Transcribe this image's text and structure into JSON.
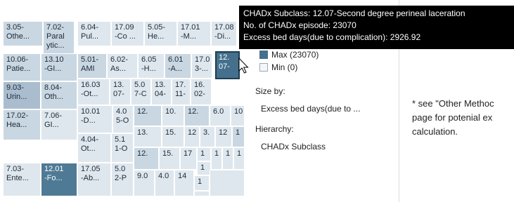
{
  "treemap": {
    "cells": [
      {
        "label": "3.05-\nOthe...",
        "color": "#c9d7e2"
      },
      {
        "label": "7.02-\nParal\nytic...",
        "color": "#c9d7e2"
      },
      {
        "label": "6.04-\nPul...",
        "color": "#dfe7ee"
      },
      {
        "label": "17.09\n-Co ...",
        "color": "#dfe7ee"
      },
      {
        "label": "5.05-\nHe...",
        "color": "#dfe7ee"
      },
      {
        "label": "17.01\n-M...",
        "color": "#dfe7ee"
      },
      {
        "label": "17.08\n-Di...",
        "color": "#dfe7ee"
      },
      {
        "label": "12.\n07-",
        "color": "#44708d"
      },
      {
        "label": "10.06-\nPatie...",
        "color": "#c9d7e2"
      },
      {
        "label": "13.10\n-GI...",
        "color": "#c9d7e2"
      },
      {
        "label": "5.01-\nAMI",
        "color": "#c9d7e2"
      },
      {
        "label": "6.02-\nAs...",
        "color": "#dfe7ee"
      },
      {
        "label": "6.05\n-H...",
        "color": "#dfe7ee"
      },
      {
        "label": "6.01\n-A...",
        "color": "#c9d7e2"
      },
      {
        "label": "17.0\n3-...",
        "color": "#dfe7ee"
      },
      {
        "label": "16.03\n-Ot...",
        "color": "#dfe7ee"
      },
      {
        "label": "13.\n07-",
        "color": "#dfe7ee"
      },
      {
        "label": "5.0\n7-C",
        "color": "#dfe7ee"
      },
      {
        "label": "13.\n04-",
        "color": "#dfe7ee"
      },
      {
        "label": "17.\n11-",
        "color": "#dfe7ee"
      },
      {
        "label": "16.\n02-",
        "color": "#dfe7ee"
      },
      {
        "label": "9.03-\nUrin...",
        "color": "#aabdce"
      },
      {
        "label": "8.04-\nOth...",
        "color": "#c9d7e2"
      },
      {
        "label": "10.01\n-D...",
        "color": "#dfe7ee"
      },
      {
        "label": "4.0\n5-O",
        "color": "#dfe7ee"
      },
      {
        "label": "12.",
        "color": "#c9d7e2"
      },
      {
        "label": "10.",
        "color": "#dfe7ee"
      },
      {
        "label": "12.",
        "color": "#c9d7e2"
      },
      {
        "label": "6.0",
        "color": "#dfe7ee"
      },
      {
        "label": "10",
        "color": "#dfe7ee"
      },
      {
        "label": "17.02-\nHea...",
        "color": "#c9d7e2"
      },
      {
        "label": "7.06-\nGI...",
        "color": "#dfe7ee"
      },
      {
        "label": "4.04-\nOt...",
        "color": "#dfe7ee"
      },
      {
        "label": "5.1\n1-O",
        "color": "#dfe7ee"
      },
      {
        "label": "13.",
        "color": "#dfe7ee"
      },
      {
        "label": "15.",
        "color": "#dfe7ee"
      },
      {
        "label": "12",
        "color": "#dfe7ee"
      },
      {
        "label": "3.",
        "color": "#dfe7ee"
      },
      {
        "label": "12",
        "color": "#dfe7ee"
      },
      {
        "label": "1",
        "color": "#c9d7e2"
      },
      {
        "label": "12.",
        "color": "#c9d7e2"
      },
      {
        "label": "15.",
        "color": "#dfe7ee"
      },
      {
        "label": "17",
        "color": "#dfe7ee"
      },
      {
        "label": "1",
        "color": "#dfe7ee"
      },
      {
        "label": "1",
        "color": "#dfe7ee"
      },
      {
        "label": "1",
        "color": "#dfe7ee"
      },
      {
        "label": "1",
        "color": "#dfe7ee"
      },
      {
        "label": "1",
        "color": "#dfe7ee"
      },
      {
        "label": "7.03-\nEnte...",
        "color": "#dfe7ee"
      },
      {
        "label": "12.01\n-Fo...",
        "color": "#4f7a96"
      },
      {
        "label": "17.05\n-Ab...",
        "color": "#dfe7ee"
      },
      {
        "label": "5.0\n2-P",
        "color": "#dfe7ee"
      },
      {
        "label": "9.0",
        "color": "#dfe7ee"
      },
      {
        "label": "4.0",
        "color": "#dfe7ee"
      },
      {
        "label": "14",
        "color": "#dfe7ee"
      },
      {
        "label": "1",
        "color": "#dfe7ee"
      },
      {
        "label": "",
        "color": "#dfe7ee"
      },
      {
        "label": "",
        "color": "#dfe7ee"
      },
      {
        "label": "",
        "color": "#dfe7ee"
      }
    ]
  },
  "legend": {
    "max_label": "Max (23070)",
    "min_label": "Min (0)",
    "max_color": "#44708d",
    "min_color": "#f4f7fa"
  },
  "controls": {
    "size_by_label": "Size by:",
    "size_by_value": "Excess bed days(due to ...",
    "hierarchy_label": "Hierarchy:",
    "hierarchy_value": "CHADx Subclass"
  },
  "tooltip": {
    "line1": "CHADx Subclass: 12.07-Second degree perineal laceration",
    "line2": "No. of CHADx episode: 23070",
    "line3": "Excess bed days(due to complication): 2926.92"
  },
  "note": {
    "line1": "* see \"Other Methoc",
    "line2": "page for potenial ex",
    "line3": "calculation."
  }
}
